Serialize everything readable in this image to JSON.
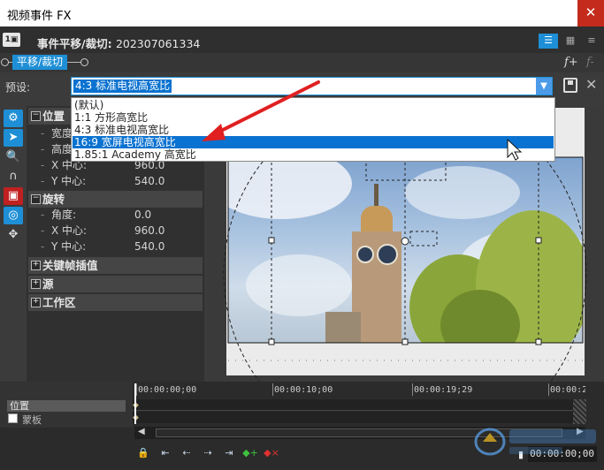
{
  "window": {
    "title": "视频事件 FX",
    "close_icon": "close-icon"
  },
  "event": {
    "title": "事件平移/裁切:",
    "id": "202307061334"
  },
  "chain": {
    "label": "平移/裁切",
    "fx_plus": "f+",
    "fx_minus": "f-"
  },
  "preset": {
    "label": "预设:",
    "value": "4:3 标准电视高宽比",
    "options": [
      "(默认)",
      "1:1 方形高宽比",
      "4:3 标准电视高宽比",
      "16:9 宽屏电视高宽比",
      "1.85:1 Academy 高宽比"
    ],
    "selected_index": 3
  },
  "properties": {
    "position": {
      "label": "位置",
      "width": "宽度",
      "height": "高度",
      "x_center": "X 中心:",
      "x_value": "960.0",
      "y_center": "Y 中心:",
      "y_value": "540.0"
    },
    "rotation": {
      "label": "旋转",
      "angle": "角度:",
      "angle_value": "0.0",
      "x_center": "X 中心:",
      "x_value": "960.0",
      "y_center": "Y 中心:",
      "y_value": "540.0"
    },
    "keyframe": "关键帧插值",
    "source": "源",
    "workspace": "工作区"
  },
  "timeline": {
    "track_label": "位置",
    "mask_label": "蒙板",
    "ticks": [
      "00:00:00;00",
      "00:00:10;00",
      "00:00:19;29",
      "00:00:2"
    ],
    "timecode": "00:00:00;00"
  },
  "colors": {
    "accent": "#1e8fd6",
    "selection": "#0a72d0",
    "arrow": "#e02020"
  }
}
